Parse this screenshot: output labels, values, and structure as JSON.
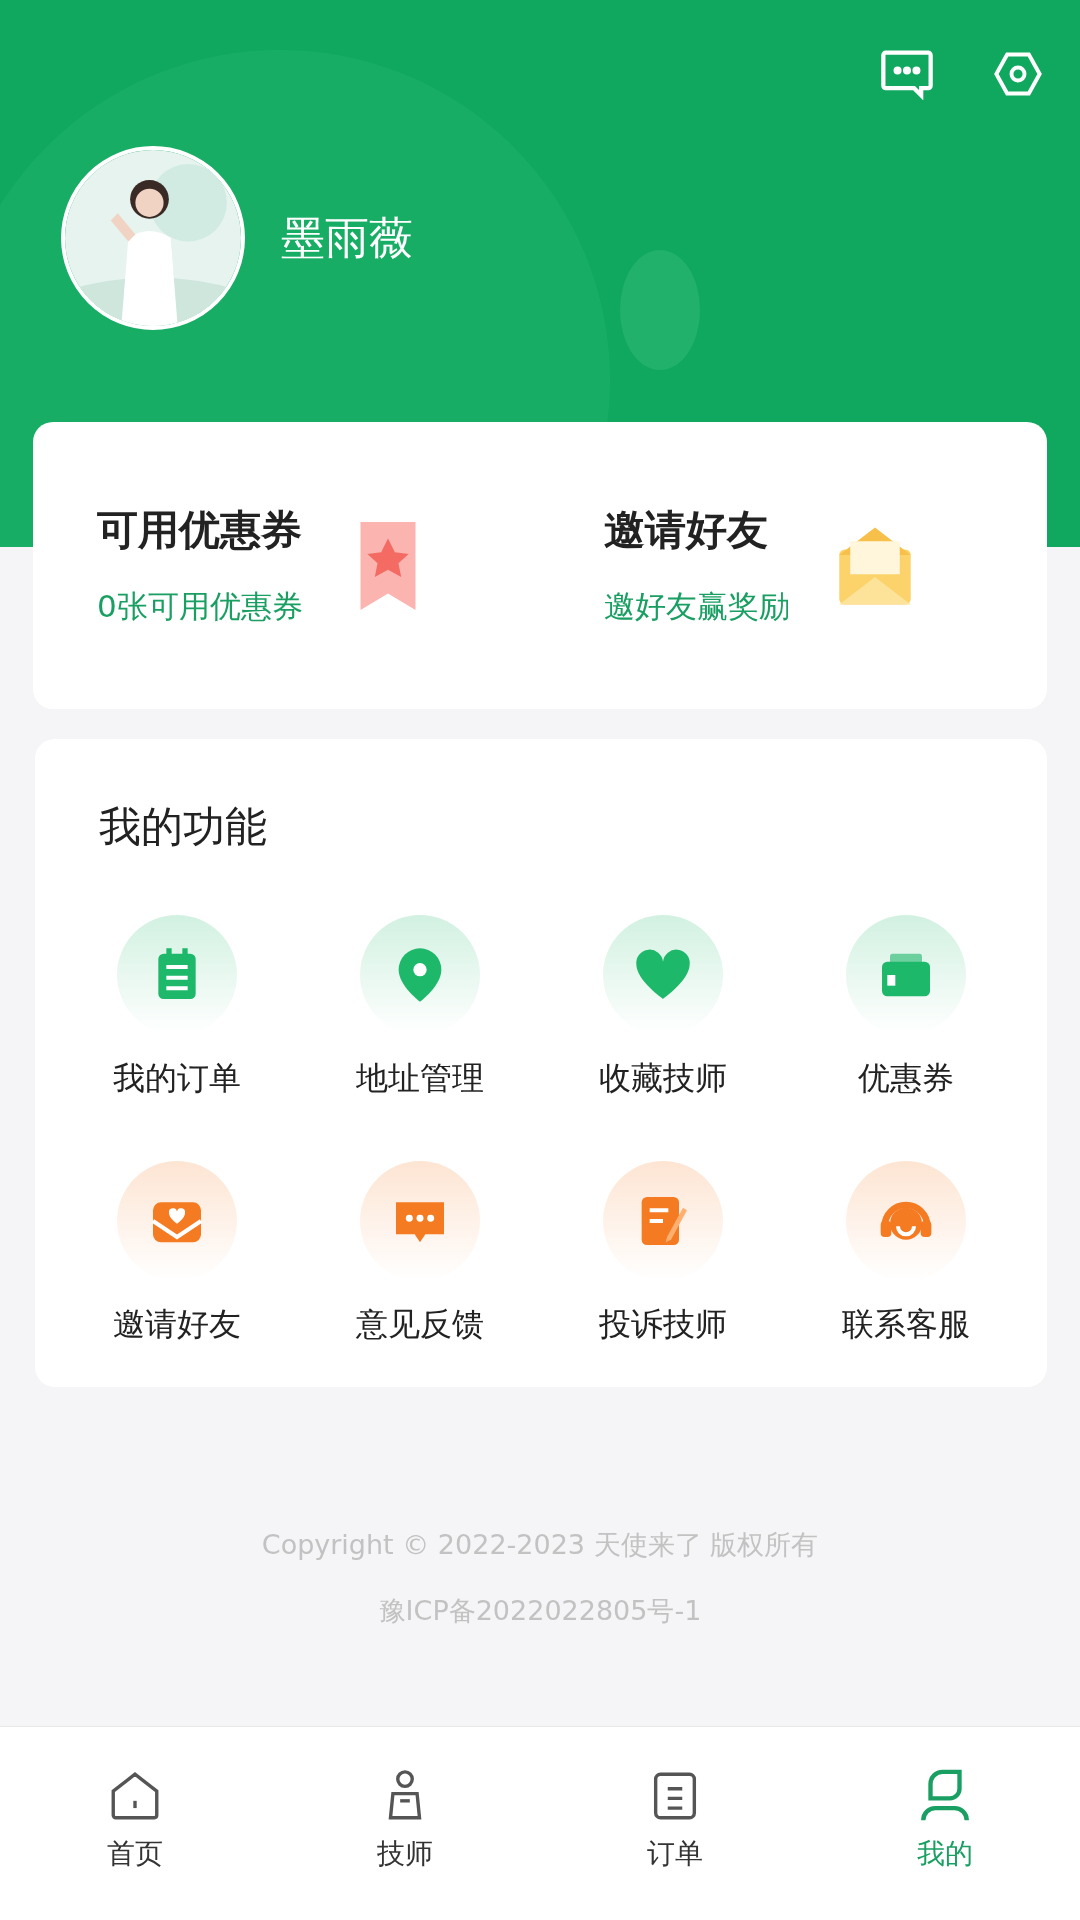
{
  "header": {
    "username": "墨雨薇"
  },
  "promo_cards": [
    {
      "title": "可用优惠券",
      "subtitle": "0张可用优惠券",
      "kind": "coupon"
    },
    {
      "title": "邀请好友",
      "subtitle": "邀好友赢奖励",
      "kind": "invite"
    }
  ],
  "features": {
    "title": "我的功能",
    "items": [
      {
        "label": "我的订单",
        "kind": "clipboard",
        "color": "#1db86a"
      },
      {
        "label": "地址管理",
        "kind": "pin",
        "color": "#1db86a"
      },
      {
        "label": "收藏技师",
        "kind": "heart",
        "color": "#1db86a"
      },
      {
        "label": "优惠券",
        "kind": "wallet",
        "color": "#1db86a"
      },
      {
        "label": "邀请好友",
        "kind": "envelope",
        "color": "#f57b22"
      },
      {
        "label": "意见反馈",
        "kind": "chat",
        "color": "#f57b22"
      },
      {
        "label": "投诉技师",
        "kind": "note",
        "color": "#f57b22"
      },
      {
        "label": "联系客服",
        "kind": "headset",
        "color": "#f57b22"
      }
    ]
  },
  "footer": {
    "copyright": "Copyright © 2022-2023 天使来了 版权所有",
    "icp": "豫ICP备2022022805号-1"
  },
  "tabs": [
    {
      "label": "首页",
      "kind": "home",
      "selected": false
    },
    {
      "label": "技师",
      "kind": "person",
      "selected": false
    },
    {
      "label": "订单",
      "kind": "doc",
      "selected": false
    },
    {
      "label": "我的",
      "kind": "me",
      "selected": true
    }
  ]
}
